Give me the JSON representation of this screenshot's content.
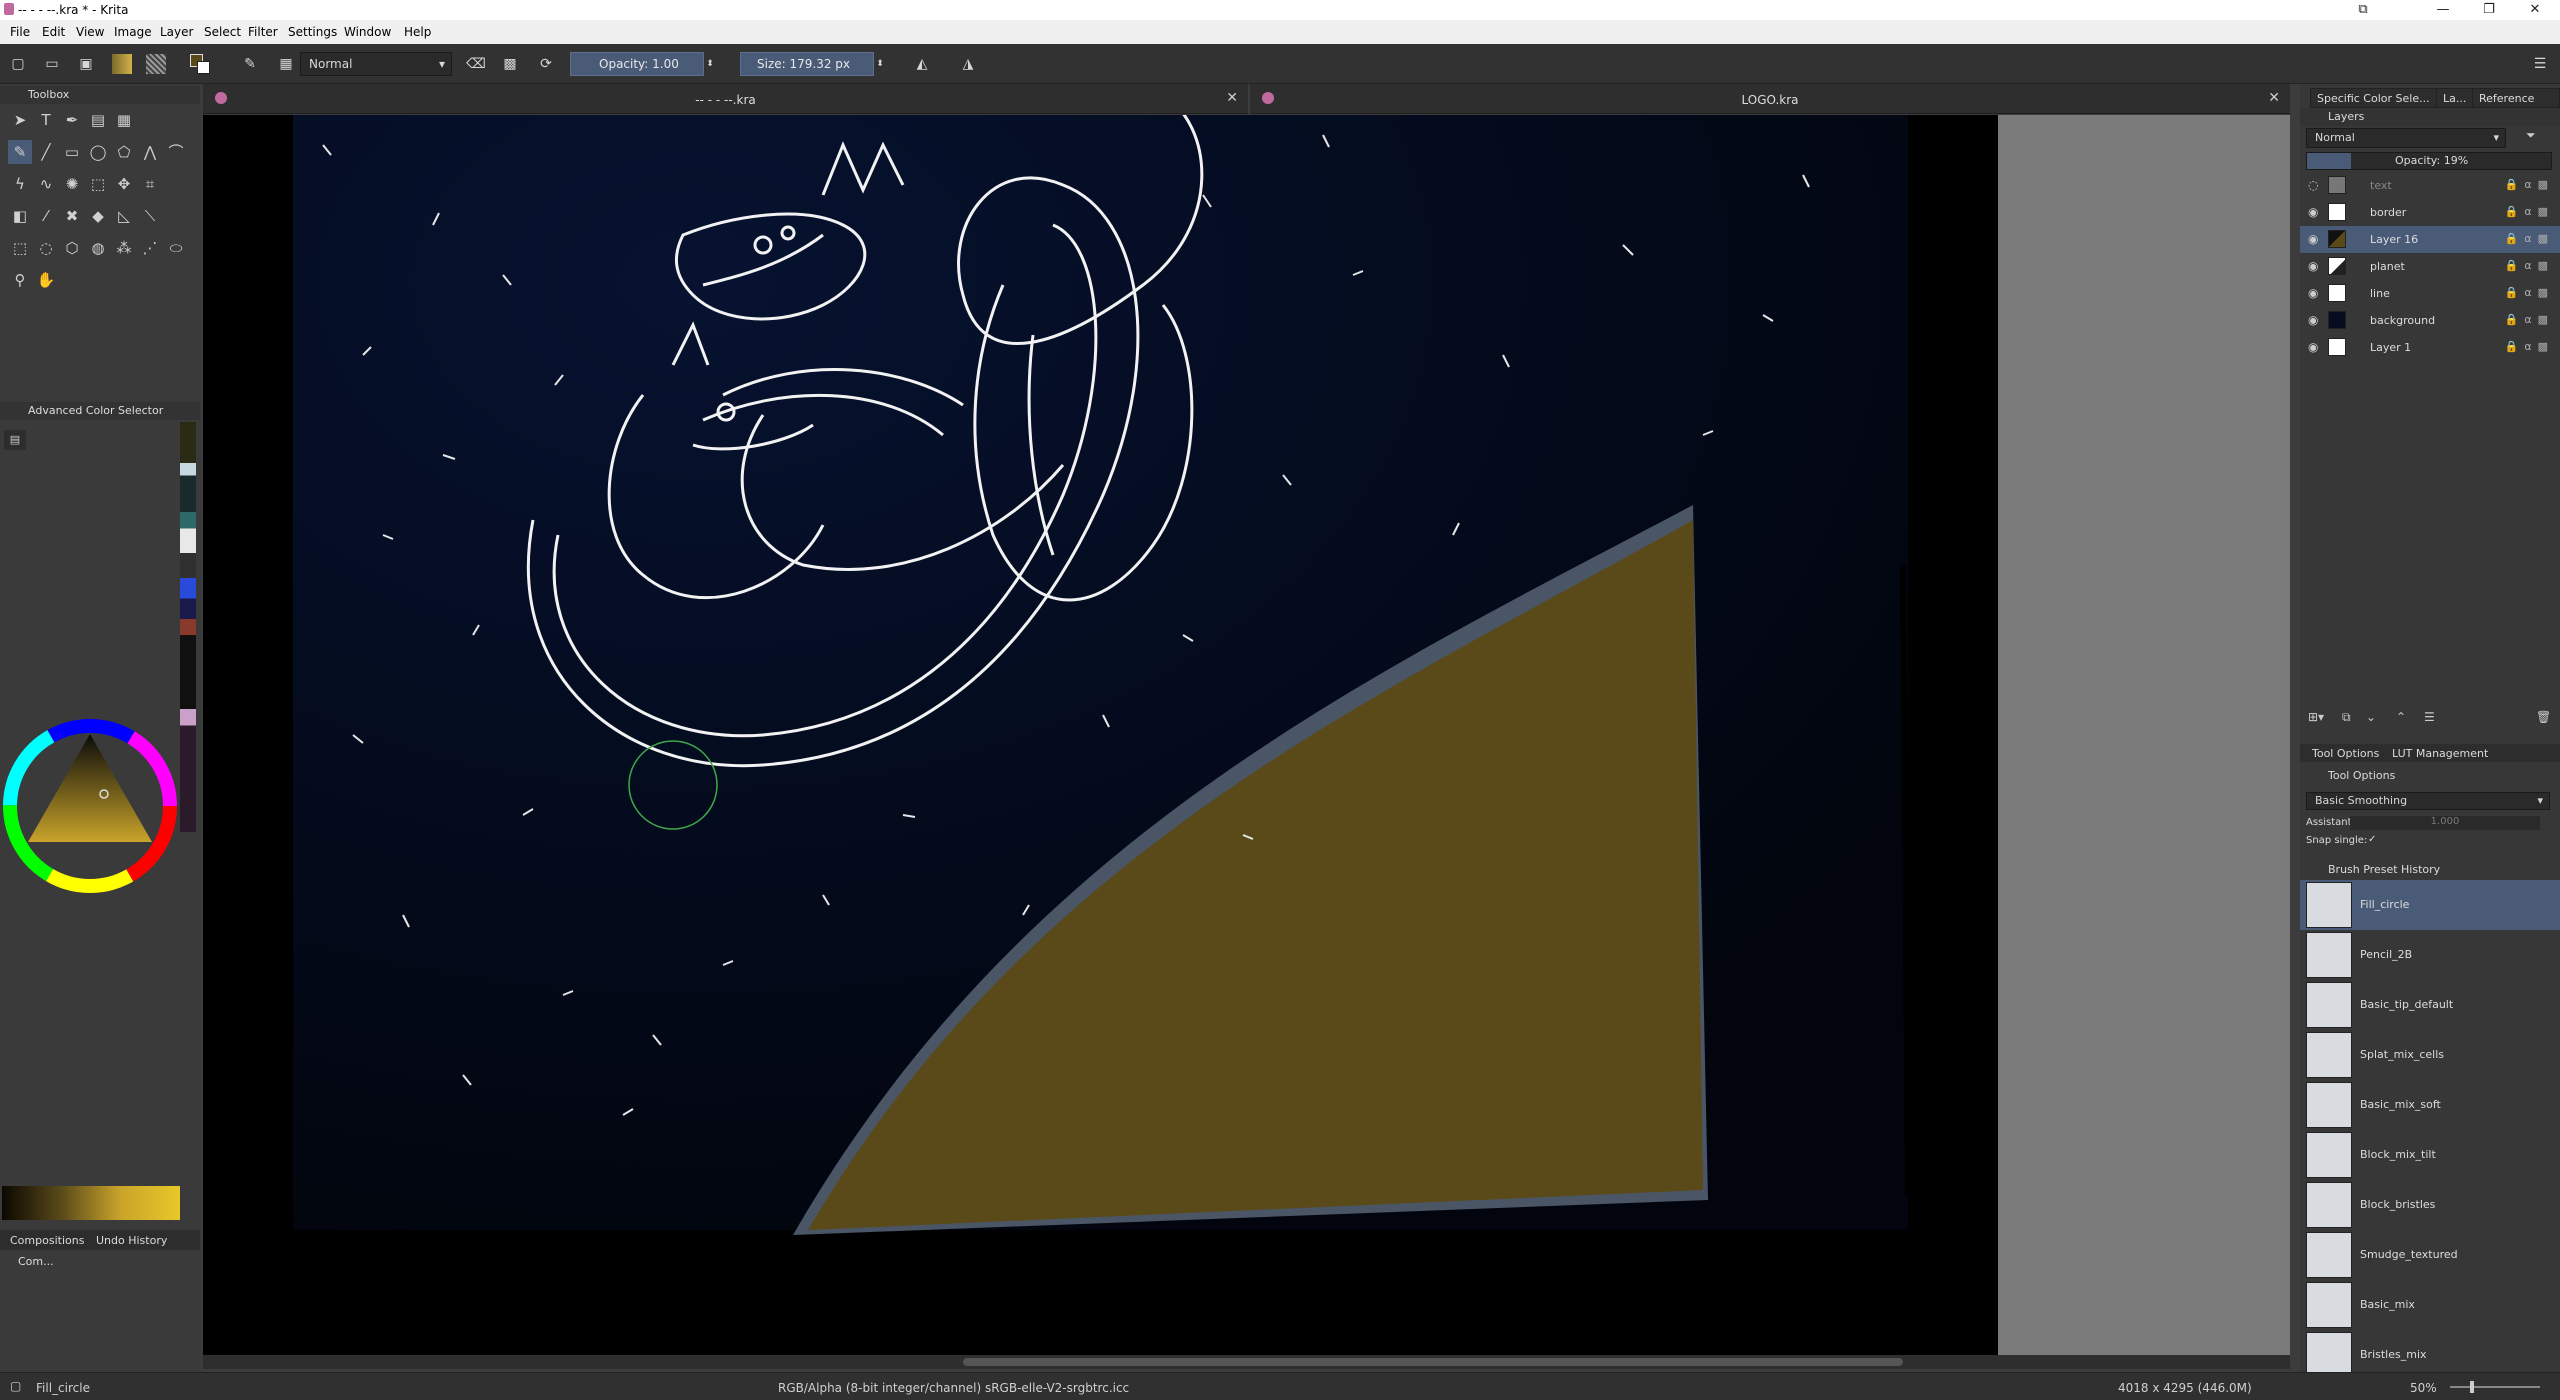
{
  "window": {
    "title": "-- - - --.kra * - Krita",
    "controls": [
      "minimize",
      "restore",
      "close"
    ]
  },
  "menu": [
    "File",
    "Edit",
    "View",
    "Image",
    "Layer",
    "Select",
    "Filter",
    "Settings",
    "Window",
    "Help"
  ],
  "toolbar": {
    "blend_mode": "Normal",
    "opacity_label": "Opacity: 1.00",
    "size_label": "Size: 179.32 px"
  },
  "left_dock": {
    "toolbox_title": "Toolbox",
    "color_selector_title": "Advanced Color Selector",
    "bottom_tabs": [
      "Compositions",
      "Undo History"
    ],
    "compositions_short": "Com..."
  },
  "documents": [
    {
      "title": "-- - - --.kra"
    },
    {
      "title": "LOGO.kra"
    }
  ],
  "right_dock": {
    "top_tabs": [
      "Specific Color Sele...",
      "La...",
      "Reference Im..."
    ],
    "layers_title": "Layers",
    "layer_blend": "Normal",
    "layer_opacity": "Opacity: 19%",
    "layers": [
      {
        "name": "text",
        "selected": false
      },
      {
        "name": "border",
        "selected": false
      },
      {
        "name": "Layer 16",
        "selected": true
      },
      {
        "name": "planet",
        "selected": false
      },
      {
        "name": "line",
        "selected": false
      },
      {
        "name": "background",
        "selected": false
      },
      {
        "name": "Layer 1",
        "selected": false
      }
    ],
    "bottom_tabs": [
      "Tool Options",
      "LUT Management"
    ],
    "tool_options_title": "Tool Options",
    "smoothing": "Basic Smoothing",
    "assistant_label": "Assistant",
    "assistant_value": "1.000",
    "snap_label": "Snap single:",
    "brush_history_title": "Brush Preset History",
    "brushes": [
      {
        "name": "Fill_circle",
        "selected": true
      },
      {
        "name": "Pencil_2B",
        "selected": false
      },
      {
        "name": "Basic_tip_default",
        "selected": false
      },
      {
        "name": "Splat_mix_cells",
        "selected": false
      },
      {
        "name": "Basic_mix_soft",
        "selected": false
      },
      {
        "name": "Block_mix_tilt",
        "selected": false
      },
      {
        "name": "Block_bristles",
        "selected": false
      },
      {
        "name": "Smudge_textured",
        "selected": false
      },
      {
        "name": "Basic_mix",
        "selected": false
      },
      {
        "name": "Bristles_mix",
        "selected": false
      }
    ]
  },
  "status": {
    "brush": "Fill_circle",
    "color_space": "RGB/Alpha (8-bit integer/channel)  sRGB-elle-V2-srgbtrc.icc",
    "dimensions": "4018 x 4295 (446.0M)",
    "zoom": "50%"
  },
  "colors": {
    "accent": "#4a5b78",
    "planet": "#5a4a1a",
    "planet_rim": "#4a5566",
    "sky": "#030814"
  }
}
